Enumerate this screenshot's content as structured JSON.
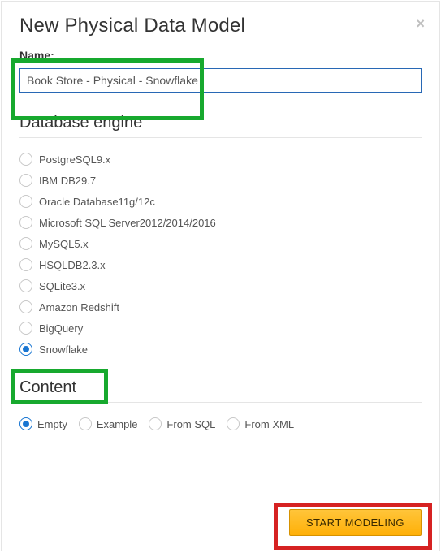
{
  "modal": {
    "title": "New Physical Data Model",
    "close": "×"
  },
  "name": {
    "label": "Name:",
    "value": "Book Store - Physical - Snowflake"
  },
  "engine": {
    "heading": "Database engine",
    "options": [
      "PostgreSQL9.x",
      "IBM DB29.7",
      "Oracle Database11g/12c",
      "Microsoft SQL Server2012/2014/2016",
      "MySQL5.x",
      "HSQLDB2.3.x",
      "SQLite3.x",
      "Amazon Redshift",
      "BigQuery",
      "Snowflake"
    ],
    "selected": "Snowflake"
  },
  "content": {
    "heading": "Content",
    "options": [
      "Empty",
      "Example",
      "From SQL",
      "From XML"
    ],
    "selected": "Empty"
  },
  "footer": {
    "start": "START MODELING"
  }
}
